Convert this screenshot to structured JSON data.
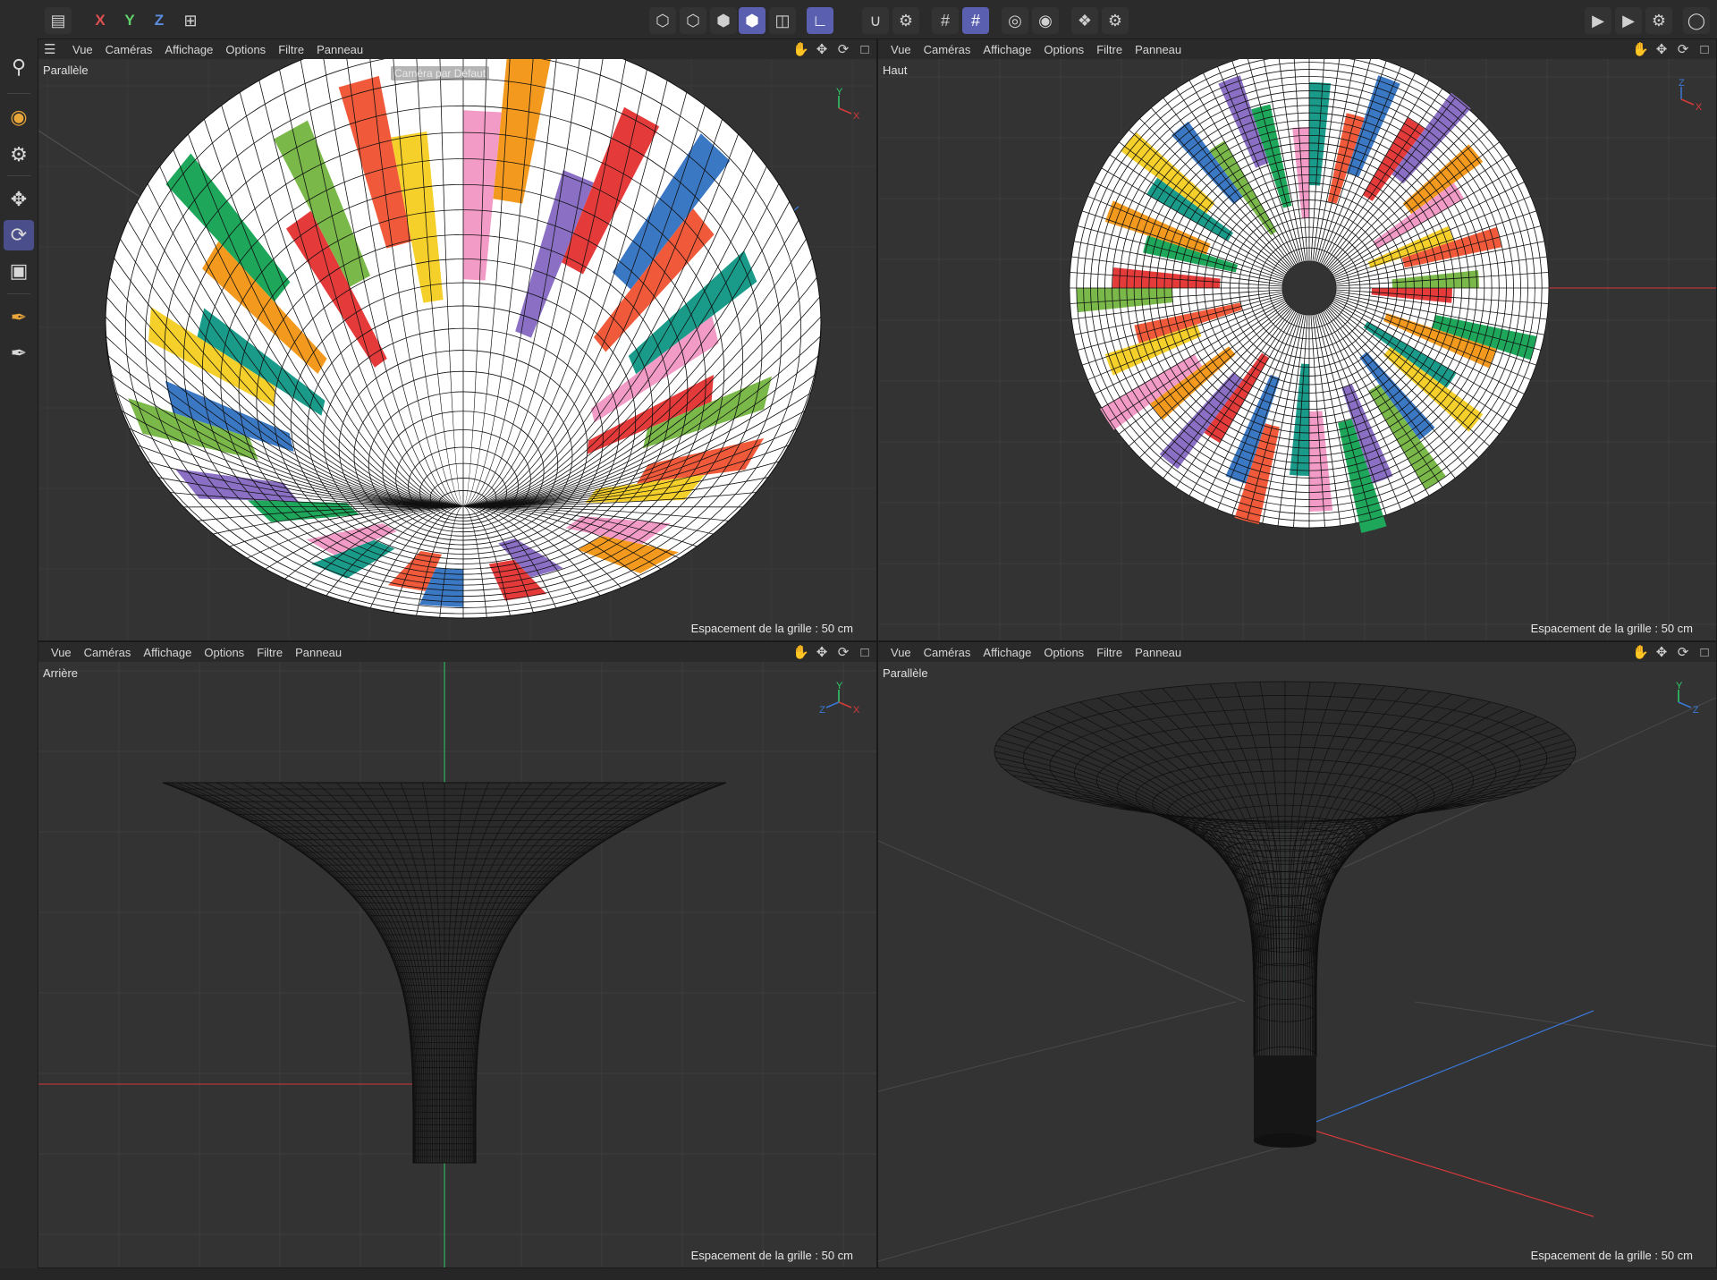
{
  "toolbar": {
    "axis_x": "X",
    "axis_y": "Y",
    "axis_z": "Z",
    "icons": [
      "undo-icon",
      "axis-x",
      "axis-y",
      "axis-z",
      "coord-system-icon",
      "points-mode-icon",
      "edges-mode-icon",
      "polygons-mode-icon",
      "model-mode-icon",
      "texture-mode-icon",
      "axis-mode-icon",
      "snap-icon",
      "snap-settings-icon",
      "grid-icon",
      "workplane-icon",
      "solo-icon",
      "solo-settings-icon",
      "symmetry-icon",
      "symmetry-settings-icon",
      "render-view-icon",
      "render-picture-viewer-icon",
      "render-settings-icon",
      "account-icon"
    ]
  },
  "left_tools": [
    "search-icon",
    "live-select-icon",
    "select-tools-icon",
    "move-icon",
    "rotate-icon",
    "scale-icon",
    "spline-pen-icon",
    "sculpt-brush-icon"
  ],
  "colors": {
    "accent": "#5a5fb0",
    "axis_x": "#d63a3a",
    "axis_y": "#2fcf6b",
    "axis_z": "#3a78d6",
    "viewport_bg": "#333333",
    "segment_palette": [
      "#e53a3a",
      "#f39a1e",
      "#f6d02a",
      "#7ab84a",
      "#1ea65a",
      "#1a9b8a",
      "#3b78c4",
      "#8a6fc4",
      "#f39bc7",
      "#f05a3a"
    ]
  },
  "viewports": [
    {
      "menu": [
        "Vue",
        "Caméras",
        "Affichage",
        "Options",
        "Filtre",
        "Panneau"
      ],
      "label": "Parallèle",
      "grid_note": "Espacement de la grille : 50 cm",
      "camera_tag": "Caméra par Défaut",
      "axis_gizmo": [
        "Y",
        "X"
      ]
    },
    {
      "menu": [
        "Vue",
        "Caméras",
        "Affichage",
        "Options",
        "Filtre",
        "Panneau"
      ],
      "label": "Haut",
      "grid_note": "Espacement de la grille : 50 cm",
      "axis_gizmo": [
        "Z",
        "X"
      ]
    },
    {
      "menu": [
        "Vue",
        "Caméras",
        "Affichage",
        "Options",
        "Filtre",
        "Panneau"
      ],
      "label": "Arrière",
      "grid_note": "Espacement de la grille : 50 cm",
      "axis_gizmo": [
        "Y",
        "X",
        "Z"
      ]
    },
    {
      "menu": [
        "Vue",
        "Caméras",
        "Affichage",
        "Options",
        "Filtre",
        "Panneau"
      ],
      "label": "Parallèle",
      "grid_note": "Espacement de la grille : 50 cm",
      "axis_gizmo": [
        "Y",
        "Z"
      ]
    }
  ]
}
